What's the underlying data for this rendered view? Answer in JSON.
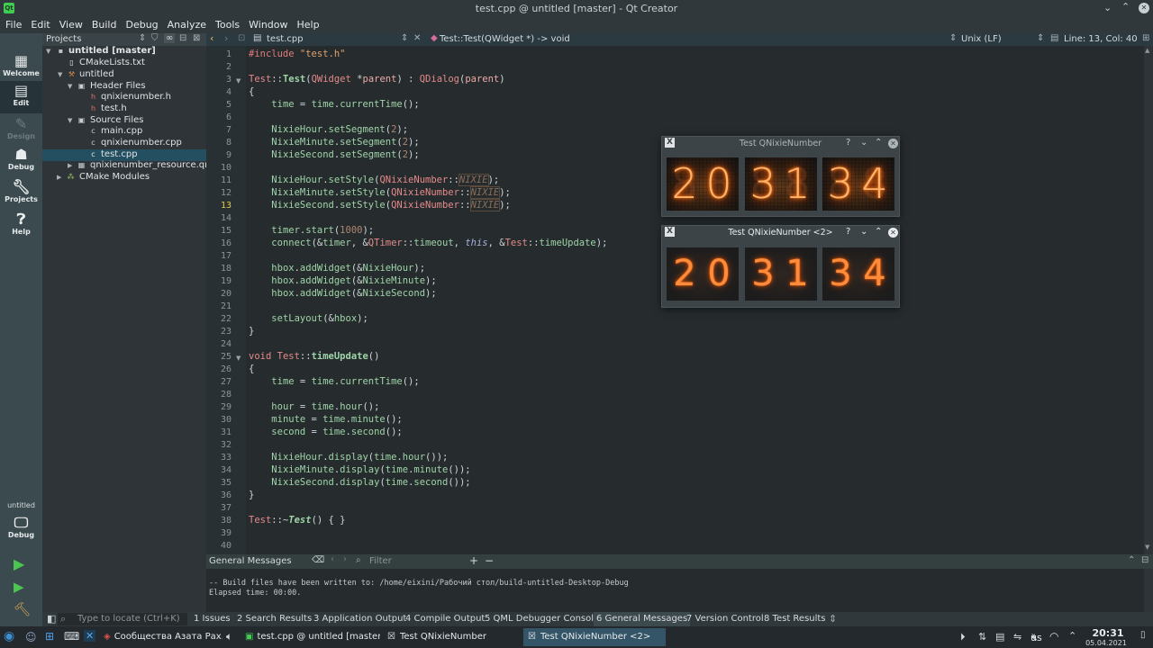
{
  "window": {
    "title": "test.cpp @ untitled [master] - Qt Creator"
  },
  "menu": [
    "File",
    "Edit",
    "View",
    "Build",
    "Debug",
    "Analyze",
    "Tools",
    "Window",
    "Help"
  ],
  "modes": {
    "welcome": "Welcome",
    "edit": "Edit",
    "design": "Design",
    "debug": "Debug",
    "projects": "Projects",
    "help": "Help"
  },
  "kit": {
    "project": "untitled",
    "config": "Debug"
  },
  "projects": {
    "header": "Projects",
    "tree": [
      {
        "label": "untitled [master]"
      },
      {
        "label": "CMakeLists.txt"
      },
      {
        "label": "untitled"
      },
      {
        "label": "Header Files"
      },
      {
        "label": "qnixienumber.h"
      },
      {
        "label": "test.h"
      },
      {
        "label": "Source Files"
      },
      {
        "label": "main.cpp"
      },
      {
        "label": "qnixienumber.cpp"
      },
      {
        "label": "test.cpp"
      },
      {
        "label": "qnixienumber_resource.qrc"
      },
      {
        "label": "CMake Modules"
      }
    ]
  },
  "editor": {
    "file": "test.cpp",
    "symbol": "Test::Test(QWidget *) -> void",
    "line_ending": "Unix (LF)",
    "position": "Line: 13, Col: 40",
    "current_line": 13,
    "line_numbers": [
      "1",
      "2",
      "3",
      "4",
      "5",
      "6",
      "7",
      "8",
      "9",
      "10",
      "11",
      "12",
      "13",
      "14",
      "15",
      "16",
      "17",
      "18",
      "19",
      "20",
      "21",
      "22",
      "23",
      "24",
      "25",
      "26",
      "27",
      "28",
      "29",
      "30",
      "31",
      "32",
      "33",
      "34",
      "35",
      "36",
      "37",
      "38",
      "39",
      "40"
    ]
  },
  "output": {
    "title": "General Messages",
    "filter": "Filter",
    "lines": [
      "-- Build files have been written to: /home/eixini/Рабочий стол/build-untitled-Desktop-Debug",
      "Elapsed time: 00:00."
    ]
  },
  "statusbar": {
    "locate": "Type to locate (Ctrl+K)",
    "tabs": [
      "1 Issues",
      "2 Search Results",
      "3 Application Output",
      "4 Compile Output",
      "5 QML Debugger Console",
      "6 General Messages",
      "7 Version Control",
      "8 Test Results"
    ]
  },
  "dialogs": [
    {
      "title": "Test QNixieNumber",
      "digits": [
        "2",
        "0",
        "3",
        "1",
        "3",
        "4"
      ],
      "active": false
    },
    {
      "title": "Test QNixieNumber <2>",
      "digits": [
        "2",
        "0",
        "3",
        "1",
        "3",
        "4"
      ],
      "active": true
    }
  ],
  "taskbar": {
    "apps": [
      "Сообщества Азата Рах...",
      "test.cpp @ untitled [master]...",
      "Test QNixieNumber",
      "Test QNixieNumber <2>"
    ],
    "layout": "us",
    "time": "20:31",
    "date": "05.04.2021"
  },
  "colors": {
    "accent": "#244f60",
    "nixie_glow": "#ff7a1a",
    "modebar": "#3b4a4e",
    "editor_bg": "#262c2e"
  }
}
